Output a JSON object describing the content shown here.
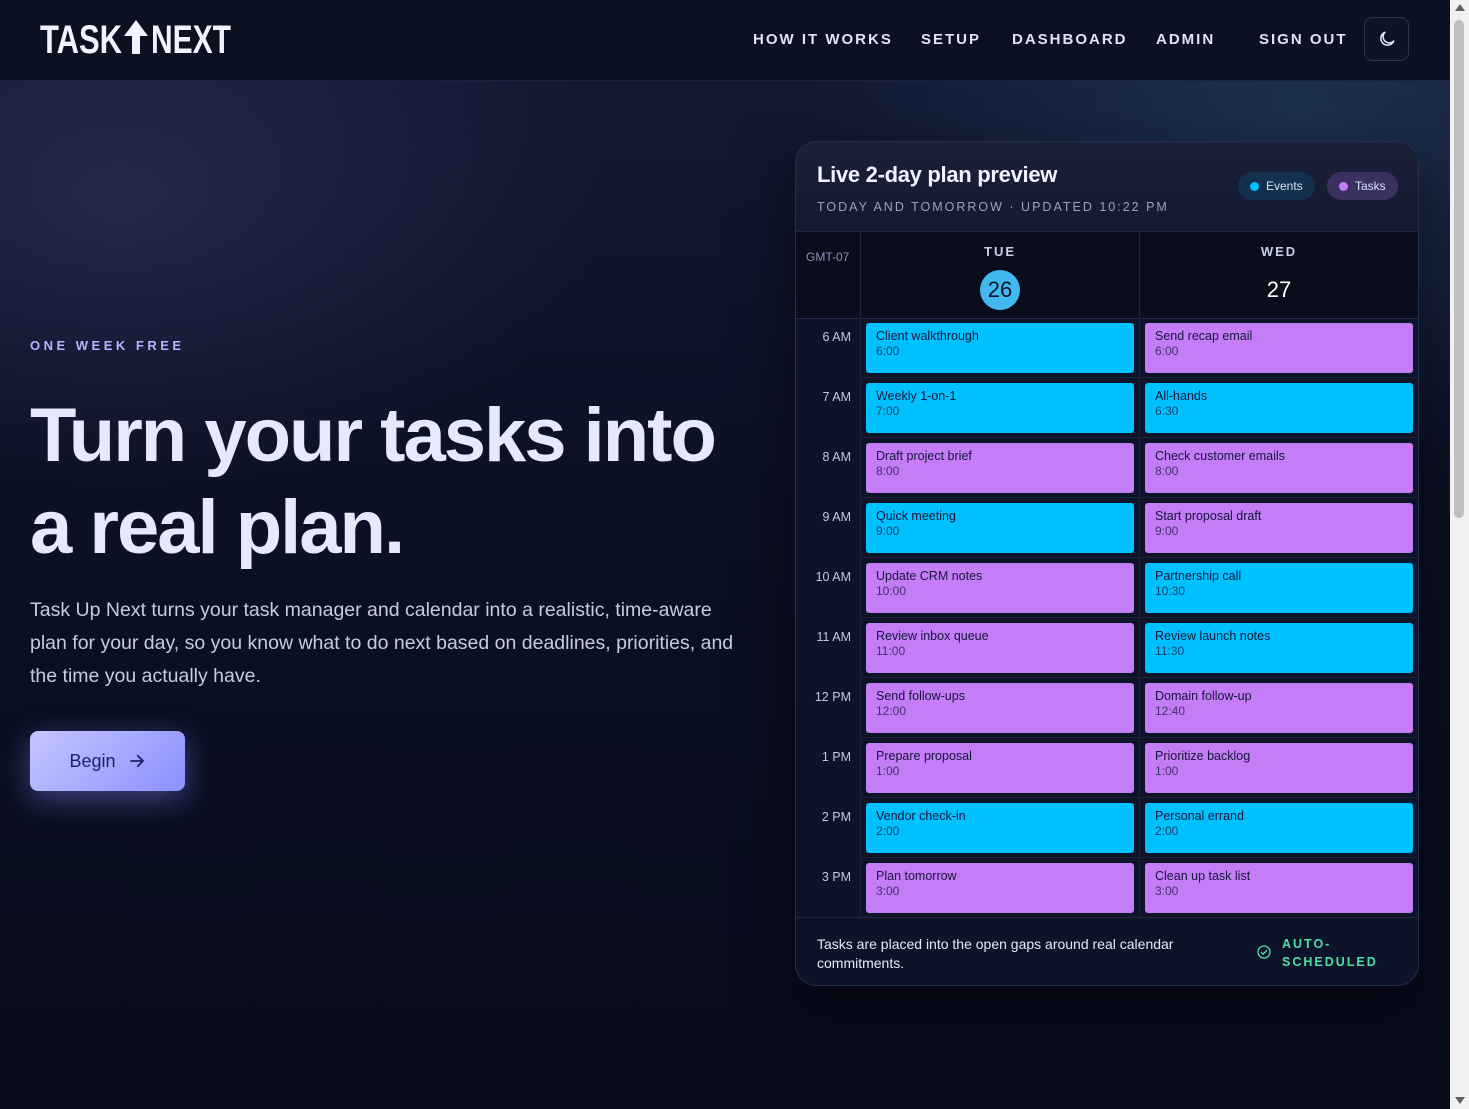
{
  "brand": {
    "logo_text": "TASK NEXT",
    "logo_icon": "up-arrow-icon"
  },
  "nav": {
    "links": [
      "HOW IT WORKS",
      "SETUP",
      "DASHBOARD",
      "ADMIN",
      "SIGN OUT"
    ],
    "theme_toggle_icon": "moon-icon"
  },
  "hero": {
    "eyebrow": "ONE WEEK FREE",
    "headline_line1": "Turn your tasks into",
    "headline_line2": "a real plan.",
    "lead": "Task Up Next turns your task manager and calendar into a realistic, time-aware plan for your day, so you know what to do next based on deadlines, priorities, and the time you actually have.",
    "cta_label": "Begin",
    "cta_icon": "arrow-right-icon"
  },
  "preview": {
    "title": "Live 2-day plan preview",
    "subtitle": "TODAY AND TOMORROW · UPDATED 10:22 PM",
    "legend": [
      {
        "label": "Events",
        "color": "#00c1ff"
      },
      {
        "label": "Tasks",
        "color": "#c47cf7"
      }
    ],
    "timezone": "GMT-07",
    "days": [
      {
        "name": "TUE",
        "num": "26",
        "today": true
      },
      {
        "name": "WED",
        "num": "27",
        "today": false
      }
    ],
    "hours": [
      "6 AM",
      "7 AM",
      "8 AM",
      "9 AM",
      "10 AM",
      "11 AM",
      "12 PM",
      "1 PM",
      "2 PM",
      "3 PM"
    ],
    "colors": {
      "event": "#00c1ff",
      "task": "#c47cf7"
    },
    "columns": [
      [
        {
          "title": "Client walkthrough",
          "time": "6:00",
          "kind": "event"
        },
        {
          "title": "Weekly 1-on-1",
          "time": "7:00",
          "kind": "event"
        },
        {
          "title": "Draft project brief",
          "time": "8:00",
          "kind": "task"
        },
        {
          "title": "Quick meeting",
          "time": "9:00",
          "kind": "event"
        },
        {
          "title": "Update CRM notes",
          "time": "10:00",
          "kind": "task"
        },
        {
          "title": "Review inbox queue",
          "time": "11:00",
          "kind": "task"
        },
        {
          "title": "Send follow-ups",
          "time": "12:00",
          "kind": "task"
        },
        {
          "title": "Prepare proposal",
          "time": "1:00",
          "kind": "task"
        },
        {
          "title": "Vendor check-in",
          "time": "2:00",
          "kind": "event"
        },
        {
          "title": "Plan tomorrow",
          "time": "3:00",
          "kind": "task"
        }
      ],
      [
        {
          "title": "Send recap email",
          "time": "6:00",
          "kind": "task"
        },
        {
          "title": "All-hands",
          "time": "6:30",
          "kind": "event"
        },
        {
          "title": "Check customer emails",
          "time": "8:00",
          "kind": "task"
        },
        {
          "title": "Start proposal draft",
          "time": "9:00",
          "kind": "task"
        },
        {
          "title": "Partnership call",
          "time": "10:30",
          "kind": "event"
        },
        {
          "title": "Review launch notes",
          "time": "11:30",
          "kind": "event"
        },
        {
          "title": "Domain follow-up",
          "time": "12:40",
          "kind": "task"
        },
        {
          "title": "Prioritize backlog",
          "time": "1:00",
          "kind": "task"
        },
        {
          "title": "Personal errand",
          "time": "2:00",
          "kind": "event"
        },
        {
          "title": "Clean up task list",
          "time": "3:00",
          "kind": "task"
        }
      ]
    ],
    "footer_text": "Tasks are placed into the open gaps around real calendar commitments.",
    "status_label": "AUTO-SCHEDULED",
    "status_icon": "check-circle-icon",
    "status_color": "#4de0a6"
  }
}
